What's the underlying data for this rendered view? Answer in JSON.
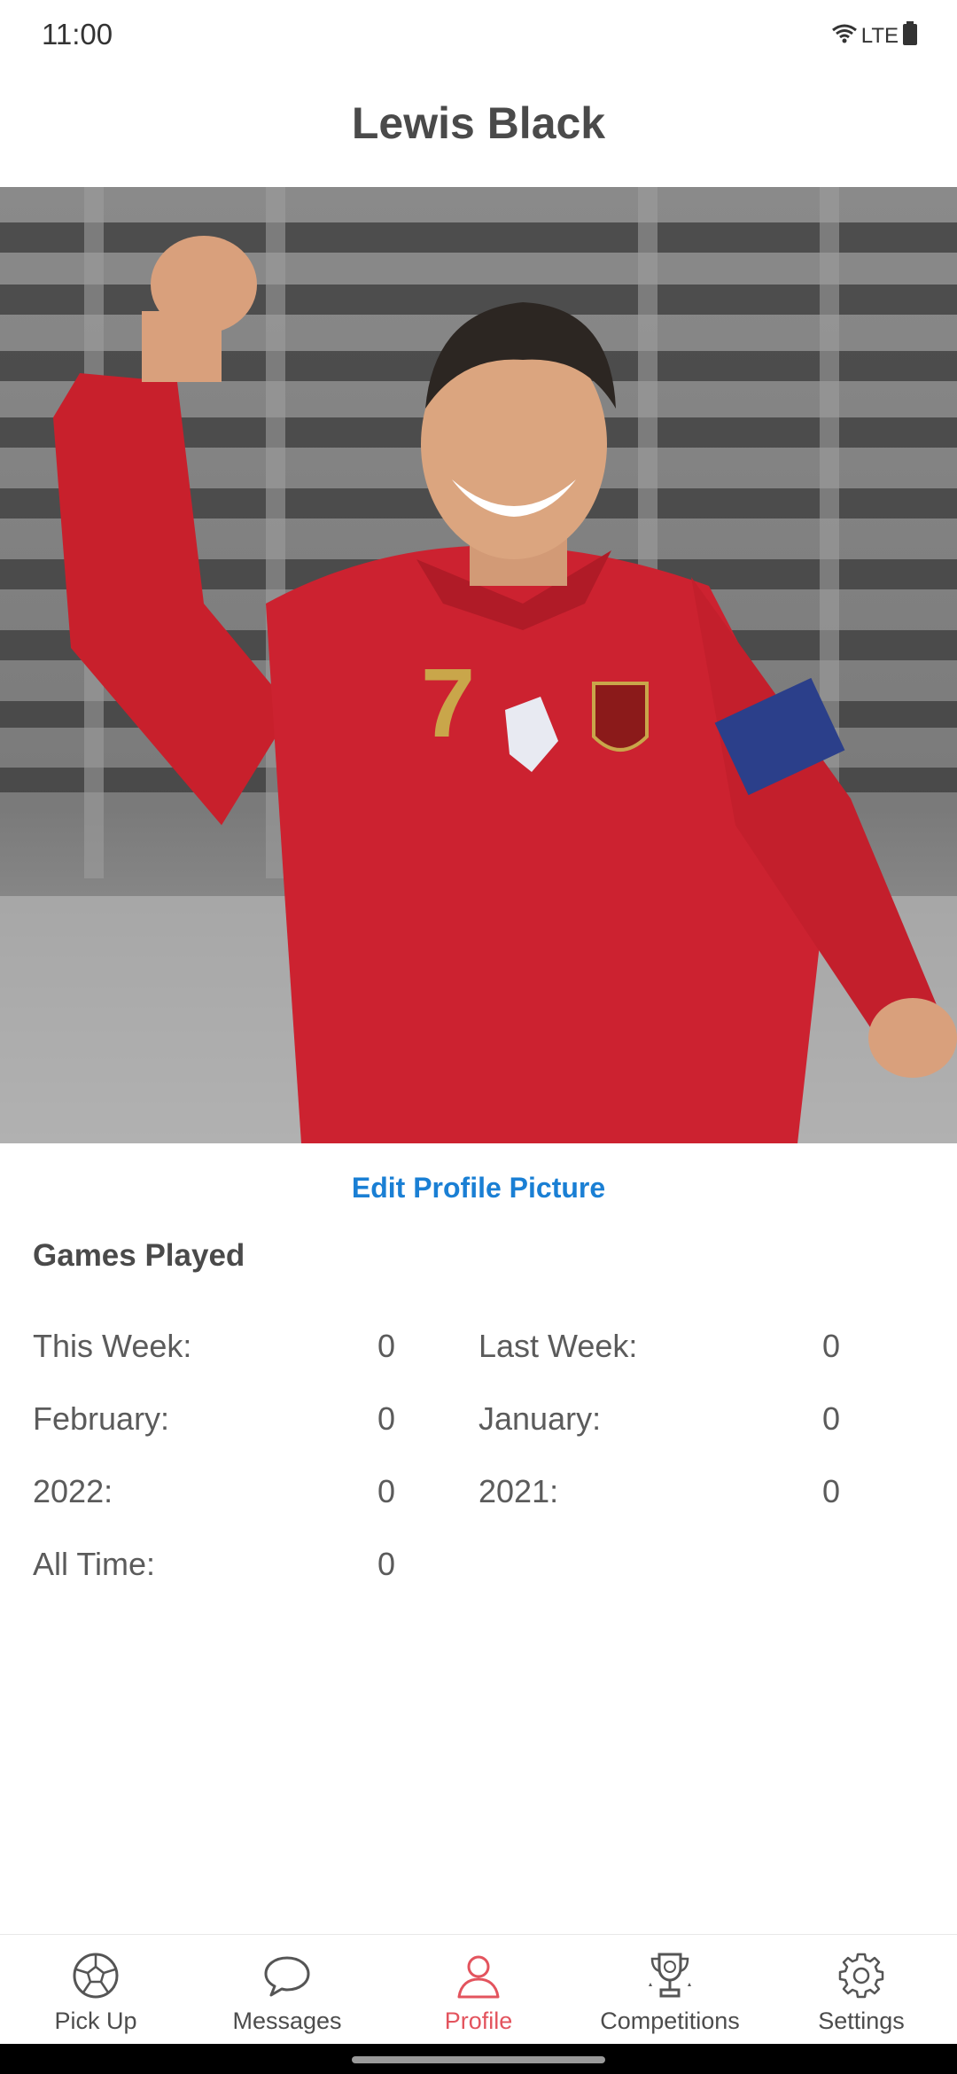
{
  "status": {
    "time": "11:00",
    "network": "LTE"
  },
  "header": {
    "title": "Lewis Black"
  },
  "profile": {
    "edit_picture_label": "Edit Profile Picture"
  },
  "games_played": {
    "title": "Games Played",
    "stats": [
      {
        "label": "This Week:",
        "value": "0"
      },
      {
        "label": "Last Week:",
        "value": "0"
      },
      {
        "label": "February:",
        "value": "0"
      },
      {
        "label": "January:",
        "value": "0"
      },
      {
        "label": "2022:",
        "value": "0"
      },
      {
        "label": "2021:",
        "value": "0"
      },
      {
        "label": "All Time:",
        "value": "0"
      }
    ]
  },
  "nav": {
    "items": [
      {
        "label": "Pick Up",
        "icon": "soccer-ball-icon"
      },
      {
        "label": "Messages",
        "icon": "chat-bubble-icon"
      },
      {
        "label": "Profile",
        "icon": "person-icon"
      },
      {
        "label": "Competitions",
        "icon": "trophy-icon"
      },
      {
        "label": "Settings",
        "icon": "gear-icon"
      }
    ],
    "active": "Profile"
  },
  "colors": {
    "accent": "#e3545e",
    "link": "#1a7fd4"
  }
}
